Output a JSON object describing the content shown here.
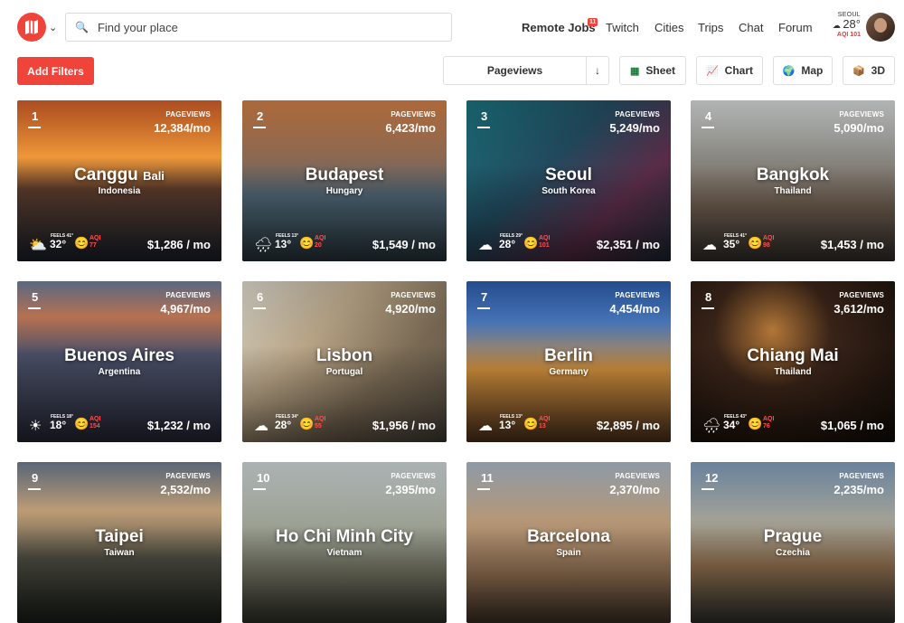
{
  "header": {
    "search_placeholder": "Find your place",
    "nav": [
      "Remote Jobs",
      "Twitch",
      "Cities",
      "Trips",
      "Chat",
      "Forum"
    ],
    "jobs_badge": "11",
    "weather": {
      "city": "SEOUL",
      "temp": "28°",
      "aqi": "AQI 101"
    }
  },
  "toolbar": {
    "add_filters": "Add Filters",
    "sort_label": "Pageviews",
    "sort_dir": "↓",
    "views": [
      "Sheet",
      "Chart",
      "Map",
      "3D"
    ]
  },
  "cards": [
    {
      "rank": "1",
      "name": "Canggu",
      "sub": "Bali",
      "country": "Indonesia",
      "pv_label": "PAGEVIEWS",
      "pageviews": "12,384/mo",
      "icon": "sun-cloud",
      "feels": "FEELS 41°",
      "temp": "32°",
      "aqi_label": "AQI",
      "aqi": "77",
      "price": "$1,286 / mo",
      "bg": "linear-gradient(180deg,#c95a26 0%,#f29a3a 35%,#5a3a2a 55%,#1e2530 100%)"
    },
    {
      "rank": "2",
      "name": "Budapest",
      "sub": "",
      "country": "Hungary",
      "pv_label": "PAGEVIEWS",
      "pageviews": "6,423/mo",
      "icon": "rain-cloud",
      "feels": "FEELS 13°",
      "temp": "13°",
      "aqi_label": "AQI",
      "aqi": "20",
      "price": "$1,549 / mo",
      "bg": "linear-gradient(180deg,#c97b45 0%,#8f6a52 35%,#4b6270 60%,#2d3b43 100%)"
    },
    {
      "rank": "3",
      "name": "Seoul",
      "sub": "",
      "country": "South Korea",
      "pv_label": "PAGEVIEWS",
      "pageviews": "5,249/mo",
      "icon": "cloud",
      "feels": "FEELS 29°",
      "temp": "28°",
      "aqi_label": "AQI",
      "aqi": "101",
      "price": "$2,351 / mo",
      "bg": "linear-gradient(135deg,#1a6f7a 0%,#224a5e 40%,#5a2c48 70%,#1e2a36 100%)"
    },
    {
      "rank": "4",
      "name": "Bangkok",
      "sub": "",
      "country": "Thailand",
      "pv_label": "PAGEVIEWS",
      "pageviews": "5,090/mo",
      "icon": "cloud",
      "feels": "FEELS 41°",
      "temp": "35°",
      "aqi_label": "AQI",
      "aqi": "98",
      "price": "$1,453 / mo",
      "bg": "linear-gradient(180deg,#cfd2d2 0%,#8b8a84 35%,#6a5a4c 65%,#3a3530 100%)"
    },
    {
      "rank": "5",
      "name": "Buenos Aires",
      "sub": "",
      "country": "Argentina",
      "pv_label": "PAGEVIEWS",
      "pageviews": "4,967/mo",
      "icon": "sun",
      "feels": "FEELS 18°",
      "temp": "18°",
      "aqi_label": "AQI",
      "aqi": "154",
      "price": "$1,232 / mo",
      "bg": "linear-gradient(180deg,#6a7a96 0%,#c37956 22%,#4a4f66 45%,#2a2d3c 100%)"
    },
    {
      "rank": "6",
      "name": "Lisbon",
      "sub": "",
      "country": "Portugal",
      "pv_label": "PAGEVIEWS",
      "pageviews": "4,920/mo",
      "icon": "cloud",
      "feels": "FEELS 34°",
      "temp": "28°",
      "aqi_label": "AQI",
      "aqi": "55",
      "price": "$1,956 / mo",
      "bg": "linear-gradient(135deg,#d7d4c8 0%,#b8a486 35%,#7a6a54 65%,#4a443c 100%)"
    },
    {
      "rank": "7",
      "name": "Berlin",
      "sub": "",
      "country": "Germany",
      "pv_label": "PAGEVIEWS",
      "pageviews": "4,454/mo",
      "icon": "cloud",
      "feels": "FEELS 13°",
      "temp": "13°",
      "aqi_label": "AQI",
      "aqi": "13",
      "price": "$2,895 / mo",
      "bg": "linear-gradient(180deg,#2a5aa6 0%,#4a7ac0 25%,#c98a3a 55%,#5a3a22 100%)"
    },
    {
      "rank": "8",
      "name": "Chiang Mai",
      "sub": "",
      "country": "Thailand",
      "pv_label": "PAGEVIEWS",
      "pageviews": "3,612/mo",
      "icon": "rain-cloud",
      "feels": "FEELS 43°",
      "temp": "34°",
      "aqi_label": "AQI",
      "aqi": "76",
      "price": "$1,065 / mo",
      "bg": "radial-gradient(circle at 40% 30%,#b87a3a 0%,#3a2418 35%,#120c08 100%)"
    },
    {
      "rank": "9",
      "name": "Taipei",
      "sub": "",
      "country": "Taiwan",
      "pv_label": "PAGEVIEWS",
      "pageviews": "2,532/mo",
      "icon": "",
      "feels": "",
      "temp": "",
      "aqi_label": "",
      "aqi": "",
      "price": "",
      "bg": "linear-gradient(180deg,#6a788a 0%,#c4a27a 30%,#4a4a40 60%,#20241e 100%)"
    },
    {
      "rank": "10",
      "name": "Ho Chi Minh City",
      "sub": "",
      "country": "Vietnam",
      "pv_label": "PAGEVIEWS",
      "pageviews": "2,395/mo",
      "icon": "",
      "feels": "",
      "temp": "",
      "aqi_label": "",
      "aqi": "",
      "price": "",
      "bg": "linear-gradient(180deg,#c9d0d0 0%,#9aa092 40%,#6a6a5a 70%,#3a3a32 100%)"
    },
    {
      "rank": "11",
      "name": "Barcelona",
      "sub": "",
      "country": "Spain",
      "pv_label": "PAGEVIEWS",
      "pageviews": "2,370/mo",
      "icon": "",
      "feels": "",
      "temp": "",
      "aqi_label": "",
      "aqi": "",
      "price": "",
      "bg": "linear-gradient(180deg,#a6b4c2 0%,#b89a7a 35%,#8a6a4e 70%,#4a3a2c 100%)"
    },
    {
      "rank": "12",
      "name": "Prague",
      "sub": "",
      "country": "Czechia",
      "pv_label": "PAGEVIEWS",
      "pageviews": "2,235/mo",
      "icon": "",
      "feels": "",
      "temp": "",
      "aqi_label": "",
      "aqi": "",
      "price": "",
      "bg": "linear-gradient(180deg,#7d99b8 0%,#a4a49a 35%,#8a6a4a 65%,#3a3a36 100%)"
    }
  ]
}
